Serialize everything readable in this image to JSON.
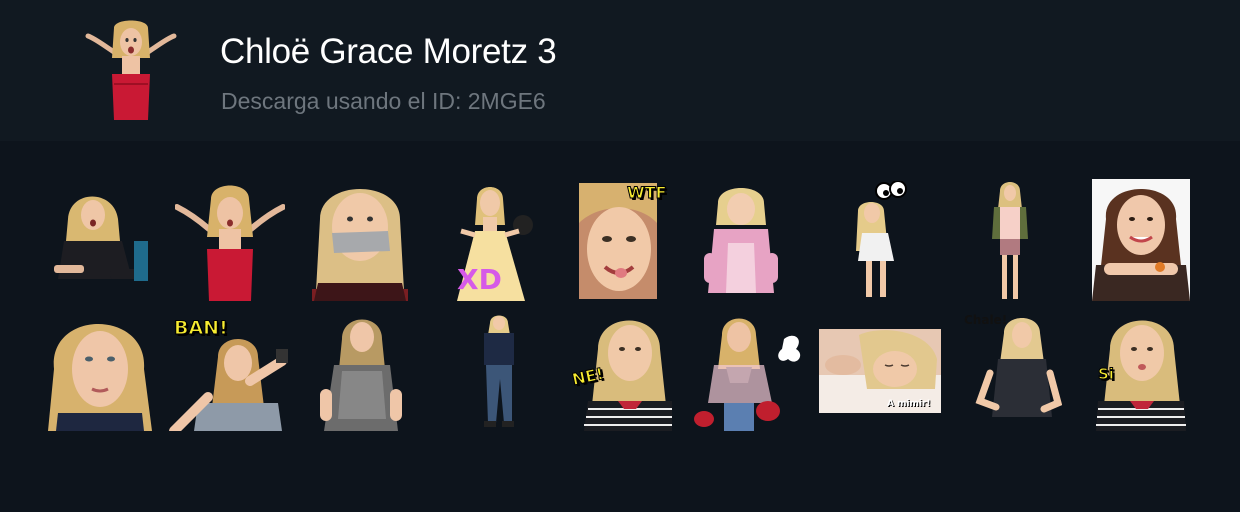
{
  "pack": {
    "title": "Chloë Grace Moretz 3",
    "subtitle": "Descarga usando el ID: 2MGE6",
    "thumbnail_icon": "sticker-thumbnail-icon"
  },
  "colors": {
    "page_bg": "#0d141c",
    "header_bg": "#111921",
    "title": "#ffffff",
    "subtitle": "#6e767e"
  },
  "stickers": [
    {
      "icon": "sticker-surprised-seated",
      "caption": ""
    },
    {
      "icon": "sticker-red-dress-shrug",
      "caption": ""
    },
    {
      "icon": "sticker-taped-mouth",
      "caption": ""
    },
    {
      "icon": "sticker-yellow-dress-xd",
      "caption": "XD"
    },
    {
      "icon": "sticker-tongue-wtf",
      "caption": "WTF"
    },
    {
      "icon": "sticker-little-girl",
      "caption": ""
    },
    {
      "icon": "sticker-googly-eyes",
      "caption": ""
    },
    {
      "icon": "sticker-standing-green-jacket",
      "caption": ""
    },
    {
      "icon": "sticker-smiling-brunette",
      "caption": ""
    },
    {
      "icon": "sticker-close-up-face",
      "caption": ""
    },
    {
      "icon": "sticker-pointing-gun-ban",
      "caption": "BAN!"
    },
    {
      "icon": "sticker-lace-dress",
      "caption": ""
    },
    {
      "icon": "sticker-walking-jeans",
      "caption": ""
    },
    {
      "icon": "sticker-striped-shirt-nel",
      "caption": "NE!"
    },
    {
      "icon": "sticker-boxing-gloves",
      "caption": ""
    },
    {
      "icon": "sticker-sleeping-a-mimir",
      "caption": "A mimir!"
    },
    {
      "icon": "sticker-chale",
      "caption": "Chale!"
    },
    {
      "icon": "sticker-striped-shirt-si",
      "caption": "Si"
    }
  ]
}
